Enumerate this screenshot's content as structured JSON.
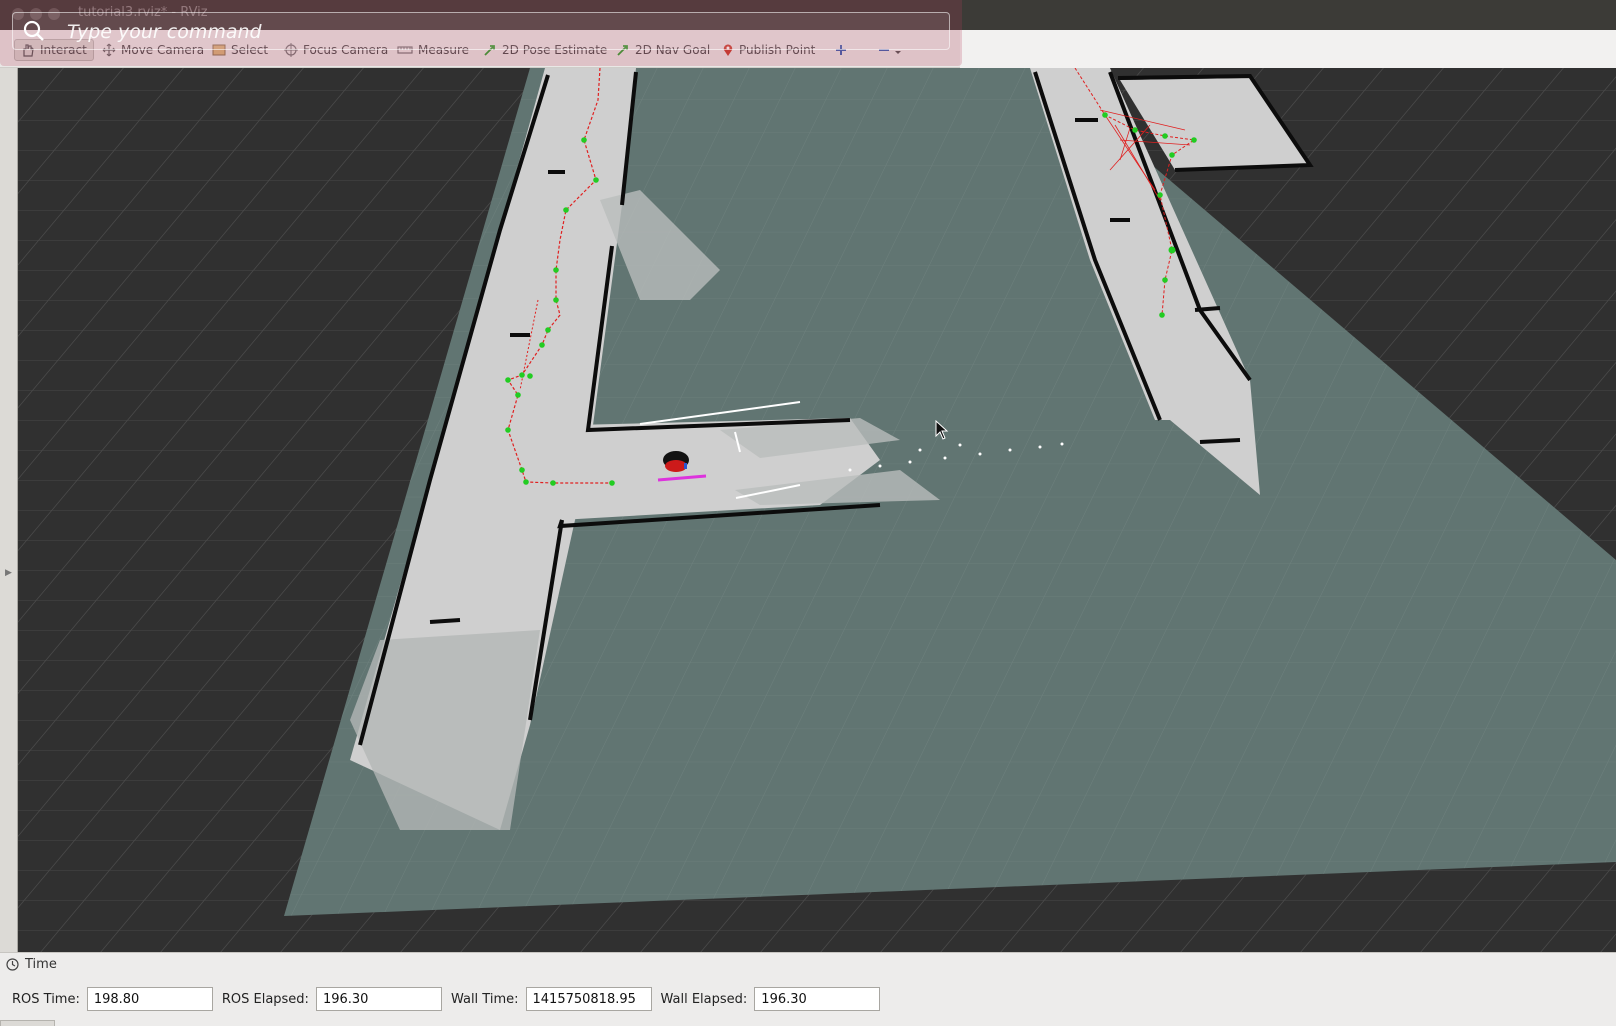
{
  "window": {
    "title": "tutorial3.rviz* - RViz"
  },
  "command_hud": {
    "placeholder": "Type your command"
  },
  "toolbar": {
    "tools": [
      {
        "label": "Interact",
        "icon": "hand-icon",
        "active": true
      },
      {
        "label": "Move Camera",
        "icon": "move-camera-icon"
      },
      {
        "label": "Select",
        "icon": "select-icon"
      },
      {
        "label": "Focus Camera",
        "icon": "focus-camera-icon"
      },
      {
        "label": "Measure",
        "icon": "ruler-icon"
      },
      {
        "label": "2D Pose Estimate",
        "icon": "pose-arrow-icon"
      },
      {
        "label": "2D Nav Goal",
        "icon": "goal-arrow-icon"
      },
      {
        "label": "Publish Point",
        "icon": "map-pin-icon"
      }
    ]
  },
  "time_panel": {
    "title": "Time",
    "ros_time_label": "ROS Time:",
    "ros_time": "198.80",
    "ros_elapsed_label": "ROS Elapsed:",
    "ros_elapsed": "196.30",
    "wall_time_label": "Wall Time:",
    "wall_time": "1415750818.95",
    "wall_elapsed_label": "Wall Elapsed:",
    "wall_elapsed": "196.30"
  },
  "colors": {
    "free_space": "#cfcfcf",
    "unknown_space": "#617572",
    "grid_line": "#4a4a4a",
    "path_red": "#e02020",
    "waypoint_green": "#22cc22",
    "robot_marker": "#cc1a1a",
    "footprint_magenta": "#dd33dd"
  }
}
